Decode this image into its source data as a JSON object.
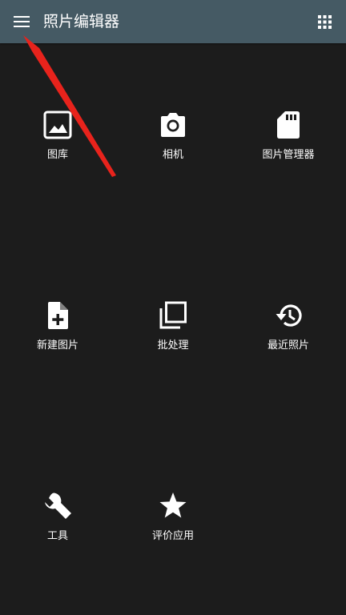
{
  "appbar": {
    "title": "照片编辑器",
    "menu_icon": "hamburger-menu-icon",
    "apps_icon": "grid-apps-icon",
    "background_color": "#455a64"
  },
  "tiles": [
    {
      "label": "图库",
      "icon": "image-icon"
    },
    {
      "label": "相机",
      "icon": "camera-icon"
    },
    {
      "label": "图片管理器",
      "icon": "sd-card-icon"
    },
    {
      "label": "新建图片",
      "icon": "add-file-icon"
    },
    {
      "label": "批处理",
      "icon": "batch-copy-icon"
    },
    {
      "label": "最近照片",
      "icon": "history-icon"
    },
    {
      "label": "工具",
      "icon": "wrench-icon"
    },
    {
      "label": "评价应用",
      "icon": "star-icon"
    }
  ],
  "colors": {
    "background": "#1c1c1c",
    "icon": "#ffffff",
    "annotation_arrow": "#e8231c"
  }
}
